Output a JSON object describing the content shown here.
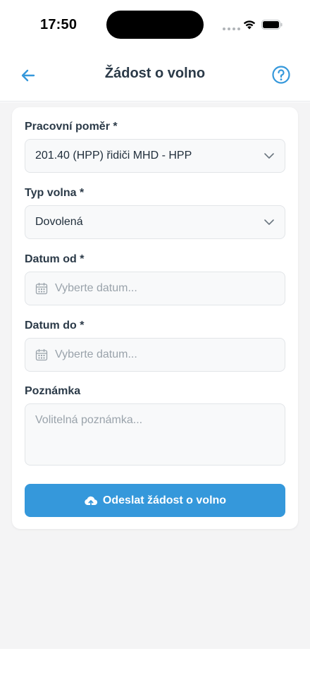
{
  "status_bar": {
    "time": "17:50"
  },
  "header": {
    "title": "Žádost o volno",
    "back_icon": "arrow-left-icon",
    "help_icon": "question-circle-icon"
  },
  "form": {
    "employment": {
      "label": "Pracovní poměr *",
      "value": "201.40 (HPP) řidiči MHD - HPP"
    },
    "leave_type": {
      "label": "Typ volna *",
      "value": "Dovolená"
    },
    "date_from": {
      "label": "Datum od *",
      "placeholder": "Vyberte datum..."
    },
    "date_to": {
      "label": "Datum do *",
      "placeholder": "Vyberte datum..."
    },
    "note": {
      "label": "Poznámka",
      "placeholder": "Volitelná poznámka..."
    },
    "submit_label": "Odeslat žádost o volno"
  },
  "colors": {
    "accent": "#3598db",
    "background": "#f4f4f5",
    "text": "#2b3a48"
  }
}
